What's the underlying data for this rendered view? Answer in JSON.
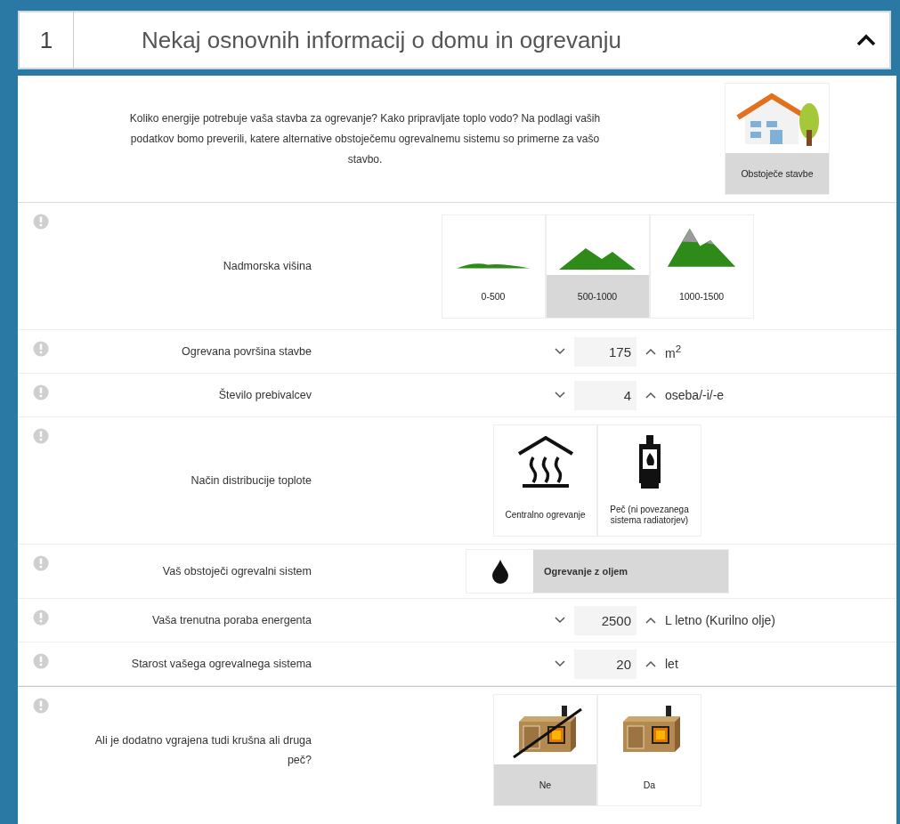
{
  "header": {
    "number": "1",
    "title": "Nekaj osnovnih informacij o domu in ogrevanju",
    "expanded": true
  },
  "intro": {
    "text": "Koliko energije potrebuje vaša stavba za ogrevanje? Kako pripravljate toplo vodo? Na podlagi vaših podatkov bomo preverili, katere alternative obstoječemu ogrevalnemu sistemu so primerne za vašo stavbo.",
    "tile": {
      "label": "Obstoječe stavbe",
      "selected": true
    }
  },
  "rows": [
    {
      "kind": "altitude",
      "label": "Nadmorska višina",
      "options": [
        {
          "label": "0-500",
          "selected": false
        },
        {
          "label": "500-1000",
          "selected": true
        },
        {
          "label": "1000-1500",
          "selected": false
        }
      ]
    },
    {
      "kind": "stepper",
      "label": "Ogrevana površina stavbe",
      "value": "175",
      "unit": "m$^{2}$"
    },
    {
      "kind": "stepper",
      "label": "Število prebivalcev",
      "value": "4",
      "unit": "oseba/-i/-e"
    },
    {
      "kind": "distribution",
      "label": "Način distribucije toplote",
      "options": [
        {
          "label": "Centralno ogrevanje",
          "selected": false
        },
        {
          "label": "Peč (ni povezanega sistema radiatorjev)",
          "selected": false
        }
      ]
    },
    {
      "kind": "select",
      "label": "Vaš obstoječi ogrevalni sistem",
      "value": "Ogrevanje z oljem"
    },
    {
      "kind": "stepper",
      "label": "Vaša trenutna poraba energenta",
      "value": "2500",
      "unit": "L letno (Kurilno olje)"
    },
    {
      "kind": "stepper",
      "label": "Starost vašega ogrevalnega sistema",
      "value": "20",
      "unit": "let"
    },
    {
      "kind": "stove",
      "label": "Ali je dodatno vgrajena tudi krušna ali druga peč?",
      "options": [
        {
          "label": "Ne",
          "selected": true
        },
        {
          "label": "Da",
          "selected": false
        }
      ]
    }
  ]
}
